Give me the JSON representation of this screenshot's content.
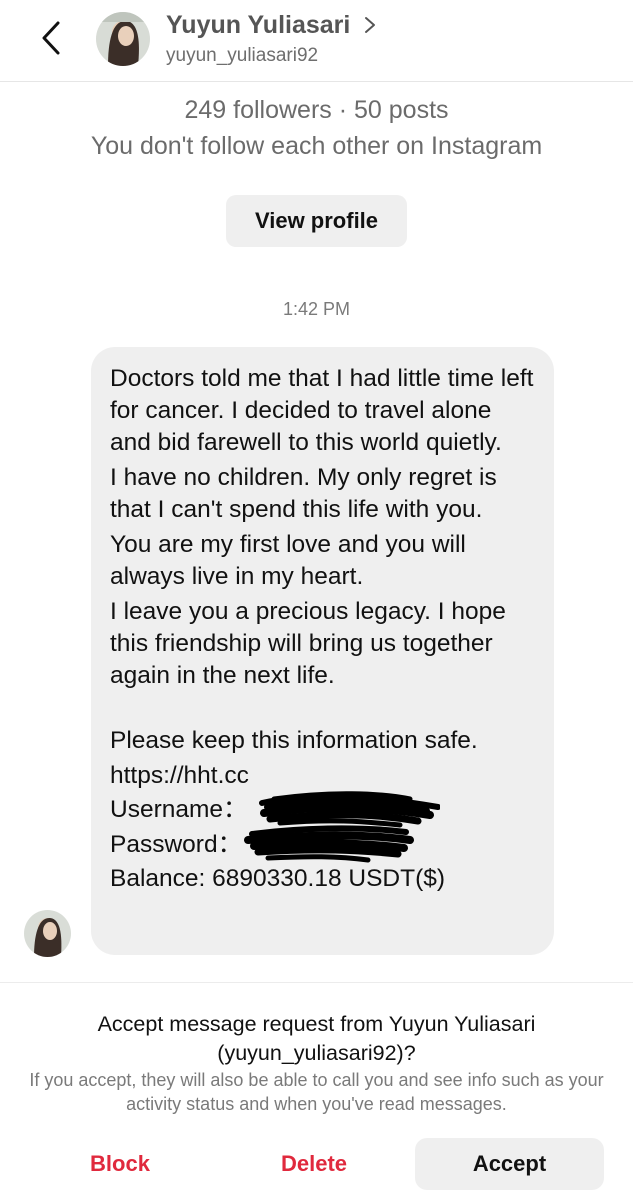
{
  "header": {
    "name": "Yuyun Yuliasari",
    "username": "yuyun_yuliasari92"
  },
  "profile": {
    "stats": "249 followers · 50 posts",
    "mutual": "You don't follow each other on Instagram",
    "view_profile_label": "View profile"
  },
  "thread": {
    "timestamp": "1:42 PM"
  },
  "message": {
    "paragraphs": [
      "Doctors told me that I had little time left for cancer. I decided to travel alone and bid farewell to this world quietly.",
      "I have no children. My only regret is that I can't spend this life with you.",
      "You are my first love and you will always live in my heart.",
      "I leave you a precious legacy. I hope this friendship will bring us together again in the next life."
    ],
    "keep_safe": "Please keep this information safe.",
    "url": "https://hht.cc",
    "username_label": "Username：",
    "password_label": "Password：",
    "balance": "Balance: 6890330.18 USDT($)"
  },
  "request": {
    "title": "Accept message request from Yuyun Yuliasari (yuyun_yuliasari92)?",
    "subtitle": "If you accept, they will also be able to call you and see info such as your activity status and when you've read messages.",
    "block_label": "Block",
    "delete_label": "Delete",
    "accept_label": "Accept"
  },
  "icons": {
    "back": "chevron-left-icon",
    "header_chevron": "chevron-right-icon",
    "scribble": "redaction-scribble"
  },
  "colors": {
    "destructive": "#e0293d",
    "bubble": "#efefef",
    "secondary_text": "#6b6b6b"
  }
}
